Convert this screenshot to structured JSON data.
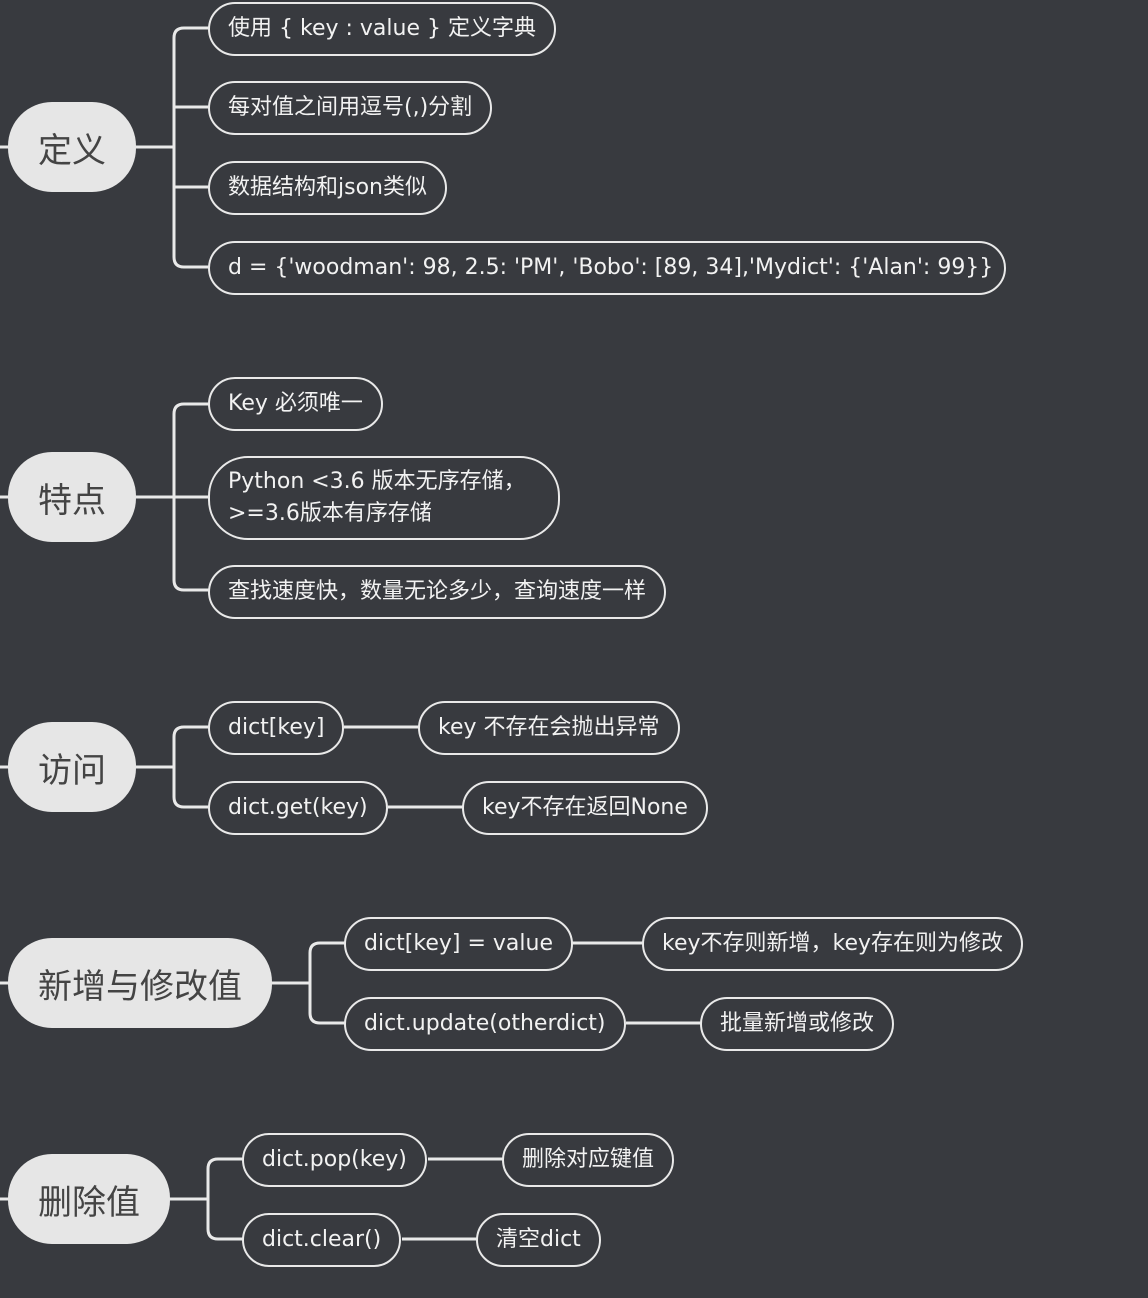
{
  "topics": [
    {
      "label": "定义",
      "children": [
        "使用 { key : value } 定义字典",
        "每对值之间用逗号(,)分割",
        "数据结构和json类似",
        "d = {'woodman': 98, 2.5: 'PM', 'Bobo': [89, 34],'Mydict': {'Alan': 99}}"
      ]
    },
    {
      "label": "特点",
      "children": [
        "Key 必须唯一",
        "Python <3.6 版本无序存储，\n>=3.6版本有序存储",
        "查找速度快，数量无论多少，查询速度一样"
      ]
    },
    {
      "label": "访问",
      "children": [
        {
          "label": "dict[key]",
          "note": "key 不存在会抛出异常"
        },
        {
          "label": "dict.get(key)",
          "note": "key不存在返回None"
        }
      ]
    },
    {
      "label": "新增与修改值",
      "children": [
        {
          "label": "dict[key] = value",
          "note": "key不存则新增，key存在则为修改"
        },
        {
          "label": "dict.update(otherdict)",
          "note": "批量新增或修改"
        }
      ]
    },
    {
      "label": "删除值",
      "children": [
        {
          "label": "dict.pop(key)",
          "note": "删除对应键值"
        },
        {
          "label": "dict.clear()",
          "note": "清空dict"
        }
      ]
    }
  ]
}
